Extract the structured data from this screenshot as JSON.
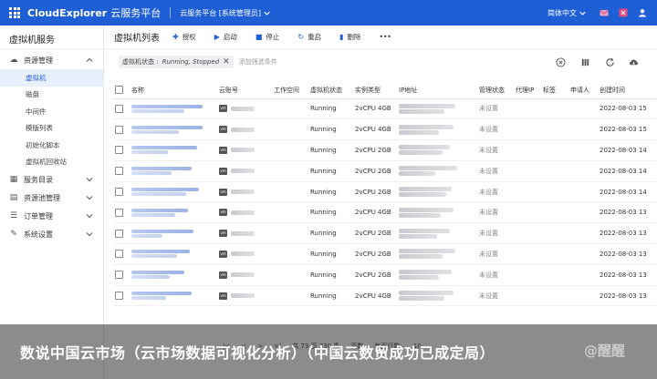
{
  "topbar": {
    "brand": "CloudExplorer",
    "brand_sub": "云服务平台",
    "platform": "云服务平台 [系统管理员]",
    "language": "简体中文",
    "icons": [
      "apps-grid-icon",
      "mail-icon",
      "close-icon",
      "user-icon"
    ]
  },
  "sidebar": {
    "title": "虚拟机服务",
    "group_resource": "资源管理",
    "items": [
      "虚拟机",
      "磁盘",
      "中间件",
      "模版列表",
      "初始化脚本",
      "虚拟机回收站"
    ],
    "groups": [
      "服务目录",
      "资源池管理",
      "订单管理",
      "系统设置"
    ]
  },
  "toolbar": {
    "title": "虚拟机列表",
    "grant": "授权",
    "start": "启动",
    "stop": "停止",
    "restart": "重启",
    "delete": "删除",
    "more": "•••"
  },
  "filter": {
    "chip_label": "虚拟机状态 :",
    "chip_value": "Running, Stopped",
    "placeholder": "添加筛选条件"
  },
  "table": {
    "headers": [
      "名称",
      "云账号",
      "工作空间",
      "虚拟机状态",
      "实例类型",
      "IP地址",
      "管理状态",
      "代理IP",
      "标签",
      "申请人",
      "创建时间"
    ],
    "rows": [
      {
        "status": "Running",
        "type": "2vCPU 4GB",
        "manage": "未设置",
        "created": "2022-08-03 15"
      },
      {
        "status": "Running",
        "type": "2vCPU 4GB",
        "manage": "未设置",
        "created": "2022-08-03 15"
      },
      {
        "status": "Running",
        "type": "2vCPU 2GB",
        "manage": "未设置",
        "created": "2022-08-03 14"
      },
      {
        "status": "Running",
        "type": "2vCPU 2GB",
        "manage": "未设置",
        "created": "2022-08-03 14"
      },
      {
        "status": "Running",
        "type": "2vCPU 2GB",
        "manage": "未设置",
        "created": "2022-08-03 14"
      },
      {
        "status": "Running",
        "type": "2vCPU 4GB",
        "manage": "未设置",
        "created": "2022-08-03 13"
      },
      {
        "status": "Running",
        "type": "2vCPU 2GB",
        "manage": "未设置",
        "created": "2022-08-03 13"
      },
      {
        "status": "Running",
        "type": "2vCPU 2GB",
        "manage": "未设置",
        "created": "2022-08-03 13"
      },
      {
        "status": "Running",
        "type": "2vCPU 2GB",
        "manage": "未设置",
        "created": "2022-08-03 13"
      },
      {
        "status": "Running",
        "type": "2vCPU 4GB",
        "manage": "未设置",
        "created": "2022-08-03 13"
      }
    ]
  },
  "pager": {
    "total": "共 73 页 730 条",
    "page": "页数",
    "page_size_label": "每页行数:",
    "page_size": "10"
  },
  "overlay": {
    "caption": "数说中国云市场（云市场数据可视化分析）（中国云数贸成功已成定局）",
    "watermark": "@醒醒"
  },
  "colors": {
    "primary": "#1f5fd6",
    "sidebar_active_bg": "#e8f0fe"
  }
}
